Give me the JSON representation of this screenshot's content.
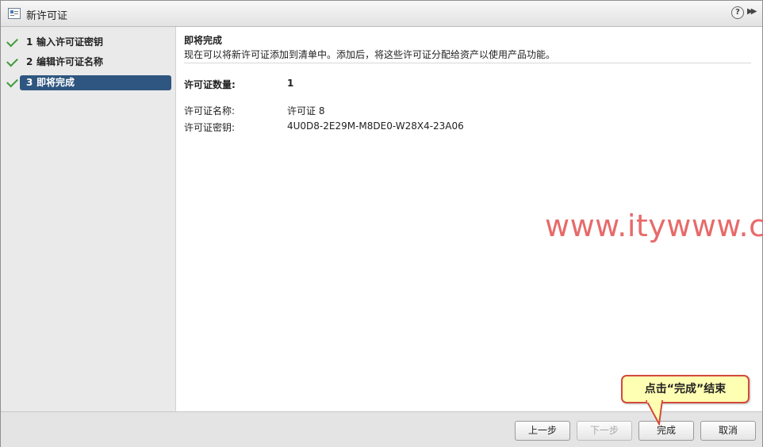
{
  "window": {
    "title": "新许可证"
  },
  "steps": [
    {
      "num": "1",
      "label": "输入许可证密钥",
      "completed": true
    },
    {
      "num": "2",
      "label": "编辑许可证名称",
      "completed": true
    },
    {
      "num": "3",
      "label": "即将完成",
      "completed": true,
      "active": true
    }
  ],
  "content": {
    "heading": "即将完成",
    "description": "现在可以将新许可证添加到清单中。添加后，将这些许可证分配给资产以使用产品功能。",
    "fields": [
      {
        "label": "许可证数量:",
        "value": "1"
      },
      {
        "label": "许可证名称:",
        "value": "许可证 8"
      },
      {
        "label": "许可证密钥:",
        "value": "4U0D8-2E29M-M8DE0-W28X4-23A06"
      }
    ]
  },
  "watermark": "www.itywww.cn",
  "callout": "点击“完成”结束",
  "buttons": {
    "back": "上一步",
    "next": "下一步",
    "finish": "完成",
    "cancel": "取消"
  },
  "colors": {
    "active_step": "#2f5680",
    "check": "#3f9a3a",
    "watermark": "#e86a6a",
    "callout_border": "#d24a3c",
    "callout_fill": "#ffffb3"
  }
}
